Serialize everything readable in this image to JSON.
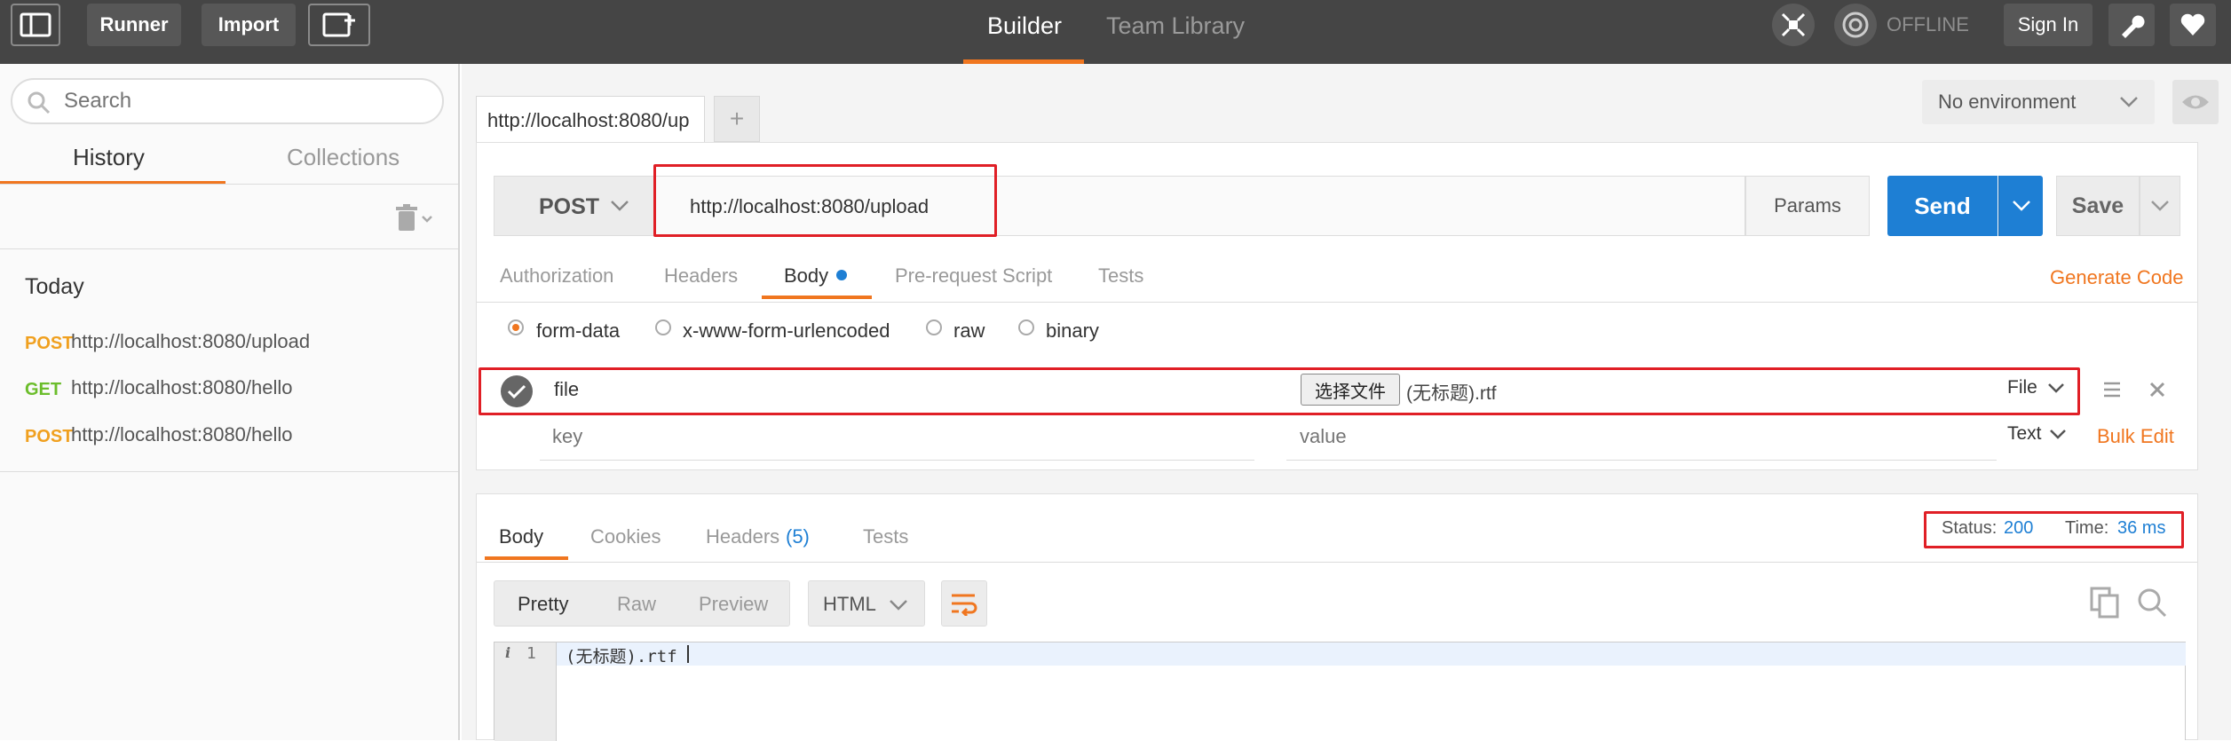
{
  "topbar": {
    "runner_label": "Runner",
    "import_label": "Import",
    "tabs": [
      "Builder",
      "Team Library"
    ],
    "offline_label": "OFFLINE",
    "signin_label": "Sign In"
  },
  "sidebar": {
    "search_placeholder": "Search",
    "tabs": [
      "History",
      "Collections"
    ],
    "group_label": "Today",
    "history": [
      {
        "method": "POST",
        "url": "http://localhost:8080/upload",
        "color": "#f0a01f"
      },
      {
        "method": "GET",
        "url": "http://localhost:8080/hello",
        "color": "#6bbd2b"
      },
      {
        "method": "POST",
        "url": "http://localhost:8080/hello",
        "color": "#f0a01f"
      }
    ]
  },
  "request_tabs": {
    "active_tab": "http://localhost:8080/up",
    "add_label": "+"
  },
  "environment": {
    "selected": "No environment"
  },
  "request": {
    "method": "POST",
    "url": "http://localhost:8080/upload",
    "params_label": "Params",
    "send_label": "Send",
    "save_label": "Save",
    "subtabs": [
      "Authorization",
      "Headers",
      "Body",
      "Pre-request Script",
      "Tests"
    ],
    "active_subtab": "Body",
    "generate_code_label": "Generate Code",
    "body_modes": [
      "form-data",
      "x-www-form-urlencoded",
      "raw",
      "binary"
    ],
    "form_rows": [
      {
        "key": "file",
        "file_button": "选择文件",
        "file_name": "(无标题).rtf",
        "type": "File"
      }
    ],
    "new_row": {
      "key_placeholder": "key",
      "value_placeholder": "value",
      "type": "Text"
    },
    "bulk_edit_label": "Bulk Edit"
  },
  "response": {
    "tabs": [
      "Body",
      "Cookies",
      "Headers",
      "Tests"
    ],
    "headers_count": "(5)",
    "status_label": "Status:",
    "status_value": "200",
    "time_label": "Time:",
    "time_value": "36 ms",
    "view_modes": [
      "Pretty",
      "Raw",
      "Preview"
    ],
    "format": "HTML",
    "code_line_number": "1",
    "code_line": "(无标题).rtf"
  },
  "colors": {
    "accent": "#f0761f",
    "send": "#1e7fd4",
    "highlight_box": "#e01f26"
  }
}
